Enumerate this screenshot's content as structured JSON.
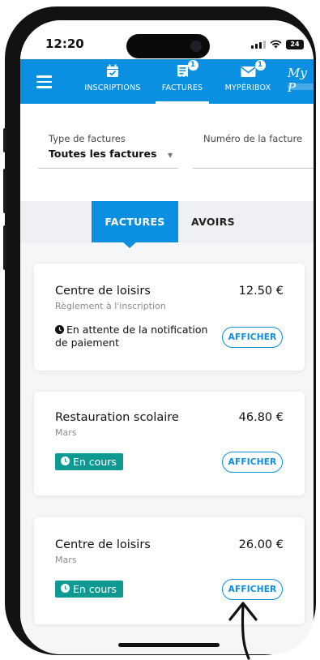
{
  "status_bar": {
    "time": "12:20",
    "battery": "24"
  },
  "nav": {
    "items": [
      {
        "label": "INSCRIPTIONS",
        "icon": "calendar-check-icon",
        "badge": ""
      },
      {
        "label": "FACTURES",
        "icon": "invoice-icon",
        "badge": "1"
      },
      {
        "label": "MYPÉRIBOX",
        "icon": "mail-icon",
        "badge": "1"
      }
    ],
    "brand": "My P",
    "active": "FACTURES",
    "colors": {
      "primary": "#0b8fe0"
    }
  },
  "filters": {
    "type_label": "Type de factures",
    "type_value": "Toutes les factures",
    "number_label": "Numéro de la facture",
    "number_value": ""
  },
  "tabs": {
    "active": "FACTURES",
    "inactive": "AVOIRS"
  },
  "invoices": [
    {
      "title": "Centre de loisirs",
      "amount": "12.50 €",
      "subtitle": "Règlement à l'inscription",
      "status": "En attente de la notification de paiement",
      "action": "AFFICHER"
    },
    {
      "title": "Restauration scolaire",
      "amount": "46.80 €",
      "subtitle": "Mars",
      "status": "En cours",
      "action": "AFFICHER"
    },
    {
      "title": "Centre de loisirs",
      "amount": "26.00 €",
      "subtitle": "Mars",
      "status": "En cours",
      "action": "AFFICHER"
    }
  ],
  "status_colors": {
    "en_cours": "#0e9a93"
  }
}
